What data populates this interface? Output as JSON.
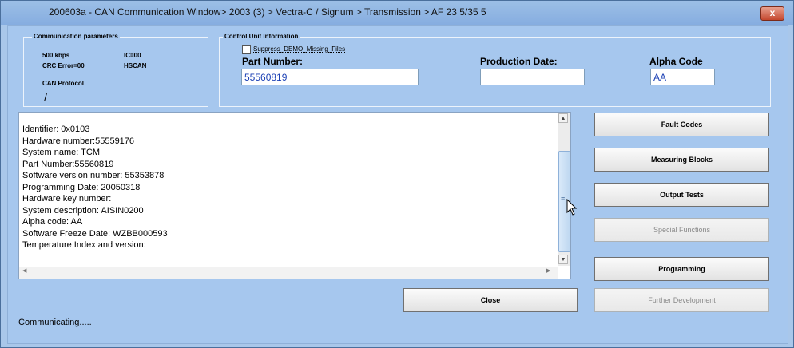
{
  "window": {
    "title": "200603a - CAN Communication Window> 2003 (3) > Vectra-C / Signum > Transmission > AF 23 5/35 5",
    "close_label": "x"
  },
  "comm_params": {
    "legend": "Communication parameters",
    "baud": "500 kbps",
    "ic": "IC=00",
    "crc": "CRC Error=00",
    "bus": "HSCAN",
    "protocol_label": "CAN Protocol",
    "protocol_value": "/"
  },
  "control_unit": {
    "legend": "Control Unit Information",
    "suppress_label": "Suppress_DEMO_Missing_Files",
    "suppress_checked": false,
    "part_number_label": "Part Number:",
    "part_number_value": "55560819",
    "production_date_label": "Production Date:",
    "production_date_value": "",
    "alpha_code_label": "Alpha Code",
    "alpha_code_value": "AA"
  },
  "info_lines": [
    "Identifier: 0x0103",
    "Hardware number:55559176",
    "System name: TCM",
    "Part Number:55560819",
    "Software version number: 55353878",
    "Programming Date: 20050318",
    "Hardware key number:",
    "System description: AISIN0200",
    "Alpha code: AA",
    "Software Freeze Date: WZBB000593",
    "Temperature Index and version:"
  ],
  "buttons": {
    "fault_codes": "Fault Codes",
    "measuring_blocks": "Measuring Blocks",
    "output_tests": "Output Tests",
    "special_functions": "Special Functions",
    "programming": "Programming",
    "close": "Close",
    "further_development": "Further Development"
  },
  "status": "Communicating.....",
  "icons": {
    "scroll_up": "▲",
    "scroll_down": "▼",
    "scroll_left": "◀",
    "scroll_right": "▶",
    "thumb_grip": "≡"
  }
}
